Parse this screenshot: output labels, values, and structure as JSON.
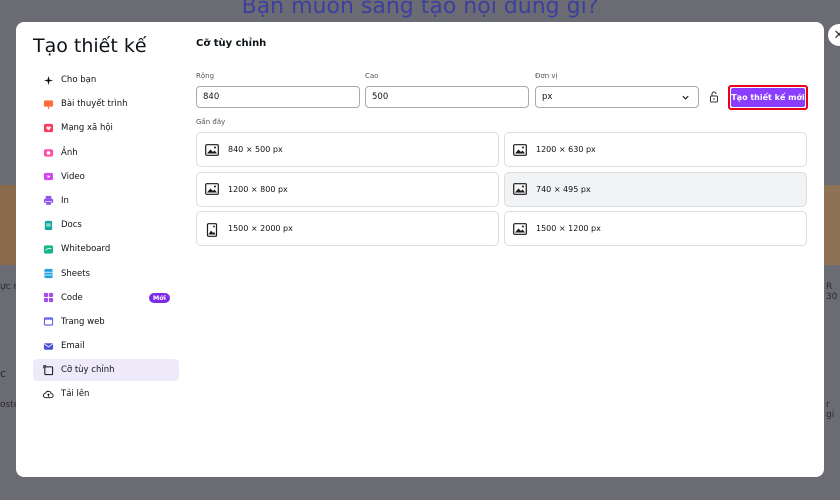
{
  "background": {
    "title": "Bạn muốn sáng tạo nội dung gì?",
    "fragments": [
      "ực m",
      "c",
      "R 30",
      "r gi",
      "oster",
      "ng tả"
    ]
  },
  "modal": {
    "title": "Tạo thiết kế",
    "nav": [
      {
        "label": "Cho bạn",
        "icon": "sparkle-icon",
        "color": "#0d1216"
      },
      {
        "label": "Bài thuyết trình",
        "icon": "presentation-icon",
        "color": "#ff6e3c"
      },
      {
        "label": "Mạng xã hội",
        "icon": "social-heart-icon",
        "color": "#ff3b5c"
      },
      {
        "label": "Ảnh",
        "icon": "camera-icon",
        "color": "#ff4fa3"
      },
      {
        "label": "Video",
        "icon": "video-icon",
        "color": "#d04cf0"
      },
      {
        "label": "In",
        "icon": "printer-icon",
        "color": "#8c55e8"
      },
      {
        "label": "Docs",
        "icon": "docs-icon",
        "color": "#13a89e"
      },
      {
        "label": "Whiteboard",
        "icon": "whiteboard-icon",
        "color": "#1bb58c"
      },
      {
        "label": "Sheets",
        "icon": "sheets-icon",
        "color": "#24a3e0"
      },
      {
        "label": "Code",
        "icon": "code-icon",
        "color": "#a34cf0",
        "badge": "Mới"
      },
      {
        "label": "Trang web",
        "icon": "website-icon",
        "color": "#6462e8"
      },
      {
        "label": "Email",
        "icon": "email-icon",
        "color": "#4a4fd8"
      },
      {
        "label": "Cỡ tùy chỉnh",
        "icon": "custom-size-icon",
        "color": "#0d1216",
        "active": true
      },
      {
        "label": "Tải lên",
        "icon": "cloud-upload-icon",
        "color": "#0d1216"
      }
    ],
    "main": {
      "title": "Cỡ tùy chỉnh",
      "width_label": "Rộng",
      "width_value": "840",
      "height_label": "Cao",
      "height_value": "500",
      "unit_label": "Đơn vị",
      "unit_value": "px",
      "create_button": "Tạo thiết kế mới",
      "recent_label": "Gần đây",
      "recent": [
        {
          "label": "840 × 500 px",
          "icon": "landscape-image-icon"
        },
        {
          "label": "1200 × 630 px",
          "icon": "landscape-image-icon"
        },
        {
          "label": "1200 × 800 px",
          "icon": "landscape-image-icon"
        },
        {
          "label": "740 × 495 px",
          "icon": "landscape-image-icon",
          "hover": true
        },
        {
          "label": "1500 × 2000 px",
          "icon": "portrait-image-icon"
        },
        {
          "label": "1500 × 1200 px",
          "icon": "landscape-image-icon"
        }
      ]
    }
  },
  "colors": {
    "accent": "#8b3dff",
    "highlight_border": "#e8001c",
    "active_nav": "#efeaf9"
  }
}
